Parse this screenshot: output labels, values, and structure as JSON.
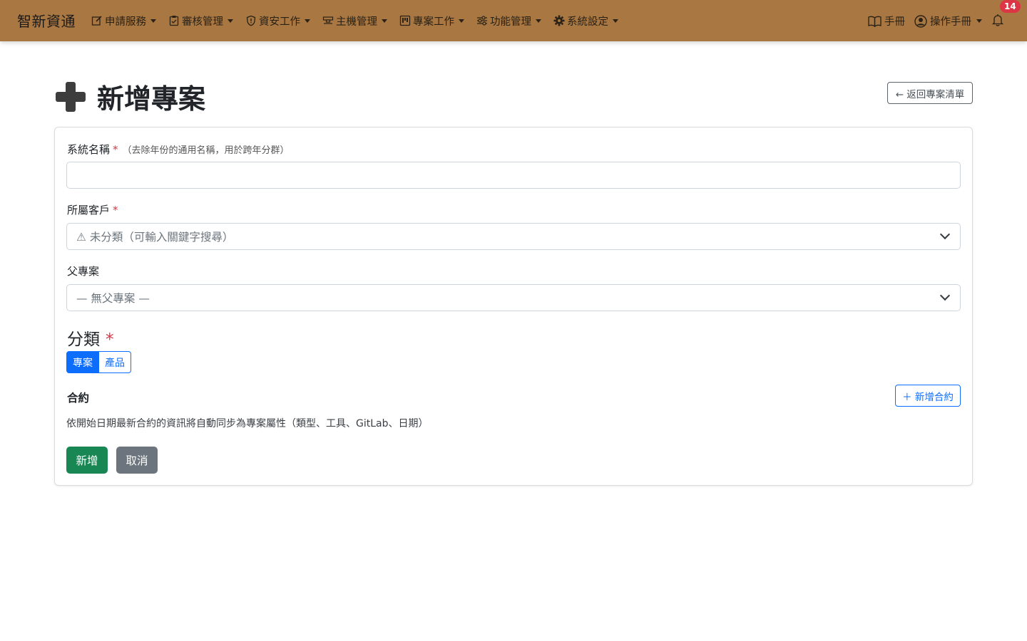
{
  "navbar": {
    "brand": "智新資通",
    "menu": [
      {
        "label": "申請服務",
        "icon": "pencil-square-icon"
      },
      {
        "label": "審核管理",
        "icon": "clipboard-check-icon"
      },
      {
        "label": "資安工作",
        "icon": "shield-icon"
      },
      {
        "label": "主機管理",
        "icon": "server-icon"
      },
      {
        "label": "專案工作",
        "icon": "kanban-icon"
      },
      {
        "label": "功能管理",
        "icon": "sliders-icon"
      },
      {
        "label": "系統設定",
        "icon": "gear-icon"
      }
    ],
    "manual_label": "手冊",
    "user_label": "操作手冊",
    "notification_count": "14"
  },
  "page": {
    "title": "新增專案",
    "back_label": "← 返回專案清單"
  },
  "form": {
    "system_name": {
      "label": "系統名稱",
      "required": "*",
      "hint": "（去除年份的通用名稱，用於跨年分群）",
      "value": ""
    },
    "customer": {
      "label": "所屬客戶",
      "required": "*",
      "selected": "⚠ 未分類（可輸入關鍵字搜尋）"
    },
    "parent_project": {
      "label": "父專案",
      "selected": "— 無父專案 —"
    },
    "category": {
      "label": "分類",
      "required": "*",
      "options": [
        "專案",
        "產品"
      ],
      "active": "專案"
    },
    "contract": {
      "label": "合約",
      "add_label": "＋ 新增合約",
      "description": "依開始日期最新合約的資訊將自動同步為專案屬性（類型、工具、GitLab、日期）"
    },
    "submit_label": "新增",
    "cancel_label": "取消"
  },
  "colors": {
    "navbar": "#a97742",
    "primary": "#0d6efd",
    "success": "#198754",
    "secondary": "#6c757d",
    "danger": "#dc3545"
  }
}
